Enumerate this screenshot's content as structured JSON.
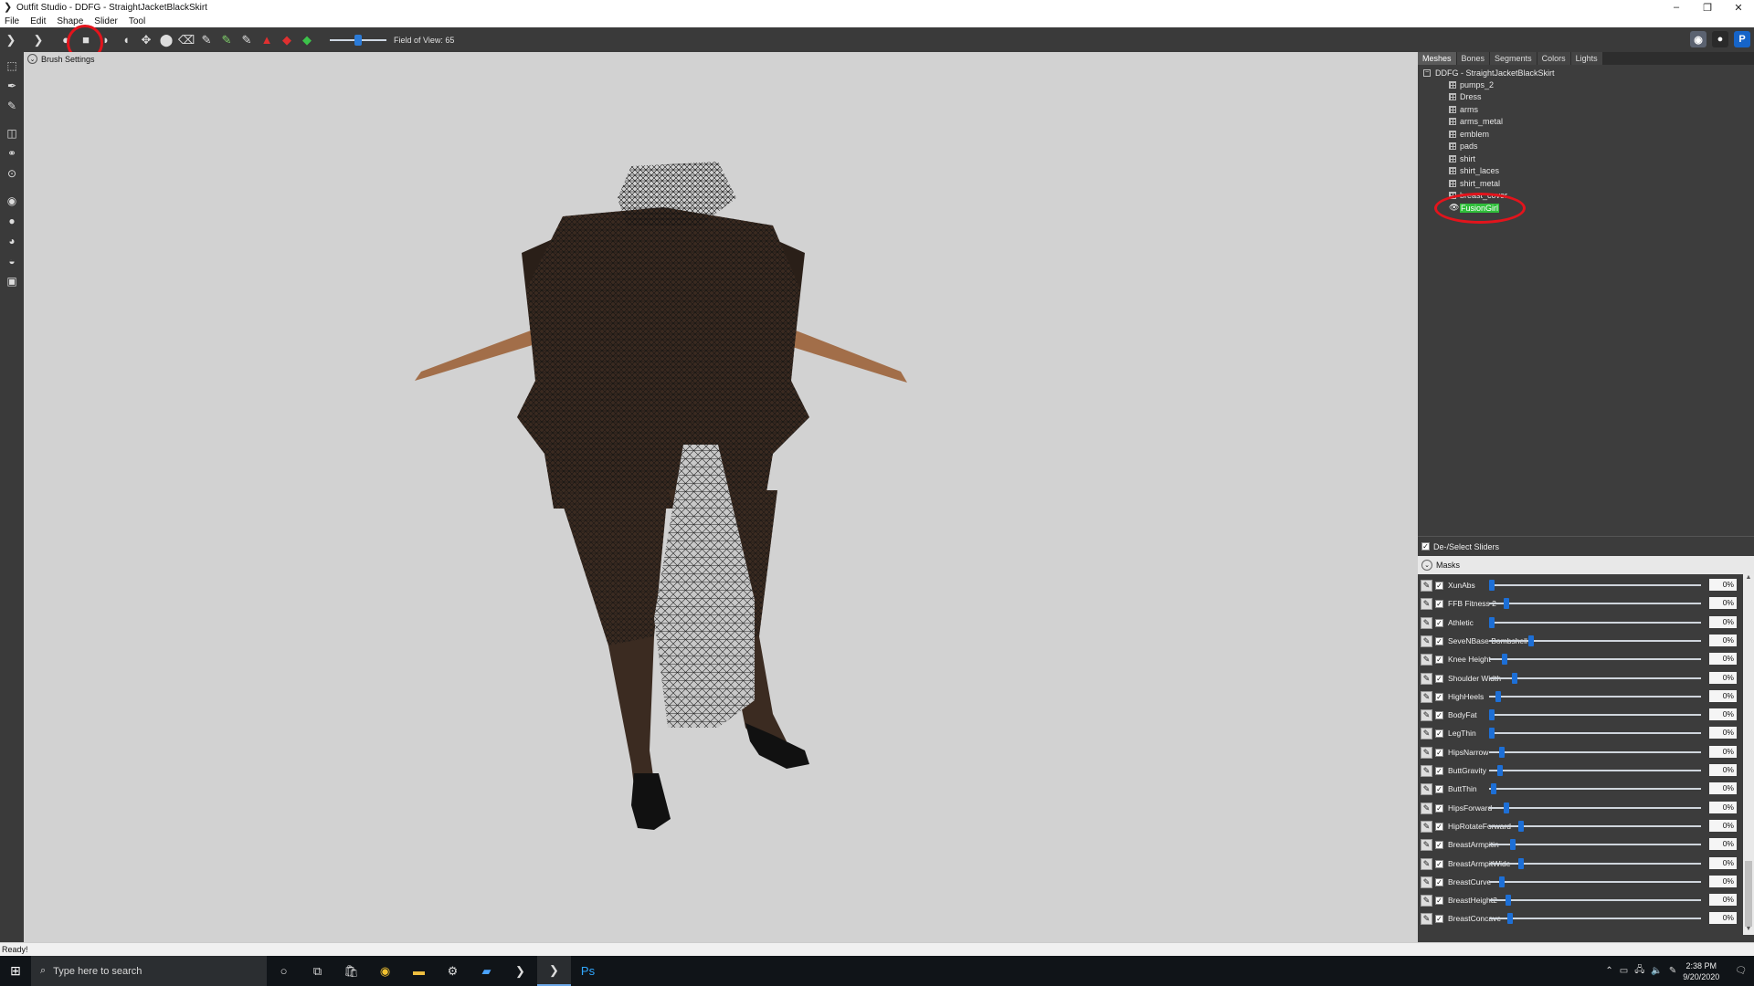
{
  "window": {
    "title": "Outfit Studio - DDFG - StraightJacketBlackSkirt",
    "controls": [
      "–",
      "❐",
      "✕"
    ]
  },
  "menu": [
    "File",
    "Edit",
    "Shape",
    "Slider",
    "Tool"
  ],
  "toolbar": {
    "fov_label": "Field of View: 65",
    "fov_value": 65
  },
  "viewport": {
    "brush_settings_label": "Brush Settings"
  },
  "panel_tabs": [
    "Meshes",
    "Bones",
    "Segments",
    "Colors",
    "Lights"
  ],
  "mesh_tree": {
    "root": "DDFG - StraightJacketBlackSkirt",
    "items": [
      "pumps_2",
      "Dress",
      "arms",
      "arms_metal",
      "emblem",
      "pads",
      "shirt",
      "shirt_laces",
      "shirt_metal",
      "breast_cover"
    ],
    "selected": "FusionGirl"
  },
  "sliders_panel": {
    "deselect_label": "De-/Select Sliders",
    "masks_label": "Masks",
    "sliders": [
      {
        "name": "XunAbs",
        "value": "0%",
        "thumb": 0.0
      },
      {
        "name": "FFB Fitness 2",
        "value": "0%",
        "thumb": 0.07
      },
      {
        "name": "Athletic",
        "value": "0%",
        "thumb": 0.0
      },
      {
        "name": "SeveNBase Bombshell",
        "value": "0%",
        "thumb": 0.19
      },
      {
        "name": "Knee Height",
        "value": "0%",
        "thumb": 0.06
      },
      {
        "name": "Shoulder Width",
        "value": "0%",
        "thumb": 0.11
      },
      {
        "name": "HighHeels",
        "value": "0%",
        "thumb": 0.03
      },
      {
        "name": "BodyFat",
        "value": "0%",
        "thumb": 0.0
      },
      {
        "name": "LegThin",
        "value": "0%",
        "thumb": 0.0
      },
      {
        "name": "HipsNarrow",
        "value": "0%",
        "thumb": 0.05
      },
      {
        "name": "ButtGravity",
        "value": "0%",
        "thumb": 0.04
      },
      {
        "name": "ButtThin",
        "value": "0%",
        "thumb": 0.01
      },
      {
        "name": "HipsForward",
        "value": "0%",
        "thumb": 0.07
      },
      {
        "name": "HipRotateForward",
        "value": "0%",
        "thumb": 0.14
      },
      {
        "name": "BreastArmpitin",
        "value": "0%",
        "thumb": 0.1
      },
      {
        "name": "BreastArmpitWide",
        "value": "0%",
        "thumb": 0.14
      },
      {
        "name": "BreastCurve",
        "value": "0%",
        "thumb": 0.05
      },
      {
        "name": "BreastHeight2",
        "value": "0%",
        "thumb": 0.08
      },
      {
        "name": "BreastConcave",
        "value": "0%",
        "thumb": 0.09
      }
    ]
  },
  "status": "Ready!",
  "taskbar": {
    "search_placeholder": "Type here to search",
    "time": "2:38 PM",
    "date": "9/20/2020"
  },
  "colors": {
    "accent_blue": "#1d6fd6",
    "selection_green": "#2fbf3a",
    "highlight_ring": "#e3141c"
  }
}
